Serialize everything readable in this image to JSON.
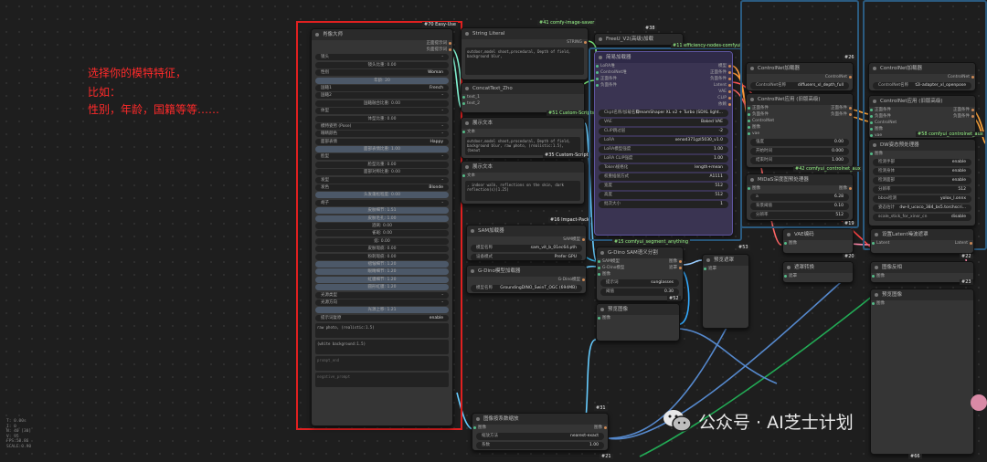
{
  "annotation": {
    "line1": "选择你的模特特征，",
    "line2": "比如：",
    "line3": "性别，年龄，国籍等等……"
  },
  "stats": [
    "T: 0.00s",
    "I: 0",
    "N: 40 [30]",
    "V: 95",
    "FPS:58.86",
    "SCALE:0.90"
  ],
  "watermark": {
    "text": "公众号 · AI芝士计划"
  },
  "nodes": {
    "portrait": {
      "tag": "#70 Easy-Use",
      "title": "肖像大师",
      "out1": "正面提示词",
      "out2": "负面提示词",
      "rows": [
        {
          "l": "镜头",
          "v": "-"
        },
        {
          "c": "镜头比重: 0.00"
        },
        {
          "l": "性别",
          "v": "Woman"
        },
        {
          "c": "年龄: 20",
          "s": true
        },
        {
          "l": "国籍1",
          "v": "French"
        },
        {
          "l": "国籍2",
          "v": "-"
        },
        {
          "c": "国籍融合比重: 0.00"
        },
        {
          "l": "体型",
          "v": "-"
        },
        {
          "c": "体型比重: 0.00"
        },
        {
          "l": "模特姿势 (Pose)",
          "v": "-"
        },
        {
          "l": "眼睛颜色",
          "v": "-"
        },
        {
          "l": "面部表情",
          "v": "Happy"
        },
        {
          "c": "面部表情比重: 1.00",
          "s": true
        },
        {
          "l": "脸型",
          "v": "-"
        },
        {
          "c": "脸型比重: 0.00"
        },
        {
          "c": "面部对称比重: 0.00"
        },
        {
          "l": "发型",
          "v": "-"
        },
        {
          "l": "发色",
          "v": "Blonde"
        },
        {
          "c": "头发蓬松程度: 0.00",
          "s": true
        },
        {
          "l": "胡子",
          "v": "-"
        },
        {
          "c": "皮肤细节: 1.51",
          "s": true
        },
        {
          "c": "皮肤毛孔: 1.00",
          "s": true
        },
        {
          "c": "酒窝: 0.00"
        },
        {
          "c": "雀斑: 0.00"
        },
        {
          "c": "痣: 0.00"
        },
        {
          "c": "皮肤瑕疵: 0.00"
        },
        {
          "c": "粉刺瑕疵: 0.00"
        },
        {
          "c": "褶皱细节: 1.20",
          "s": true
        },
        {
          "c": "眼睛细节: 1.20",
          "s": true
        },
        {
          "c": "虹膜细节: 1.20",
          "s": true
        },
        {
          "c": "圆形虹膜: 1.20",
          "s": true
        },
        {
          "l": "光源类型",
          "v": "-"
        },
        {
          "l": "光源方向",
          "v": "-"
        },
        {
          "c": "光源上移: 1.21",
          "s": true
        },
        {
          "l": "提示词复原",
          "v": "enable"
        }
      ],
      "texts": [
        "raw photo, (realistic:1.5)",
        "(white background:1.5)",
        "prompt_end",
        "negative_prompt"
      ]
    },
    "string_literal": {
      "tag": "#41 comfy-image-saver",
      "title": "String Literal",
      "out": "STRING",
      "text": "outdoor,model shoot,procedural, Depth of field, background blur,"
    },
    "concat": {
      "tag": "#51 Custom-Scripts",
      "title": "ConcatText_Zho",
      "in1": "text_1",
      "in2": "text_2",
      "out": "text"
    },
    "show1": {
      "tag": "#35 Custom-Scripts",
      "title": "展示文本",
      "in": "文本",
      "out": "字符串",
      "text": "outdoor,model shoot,procedural, Depth of field, background blur, raw photo, (realistic:1.5), (beaut"
    },
    "show2": {
      "title": "展示文本",
      "in": "文本",
      "out": "字符串",
      "text": ", indoor walk, reflections on the skin, dark reflection(s)(1.25)"
    },
    "sam_loader": {
      "tag": "#16 Impact-Pack",
      "title": "SAM加载器",
      "out": "SAM模型",
      "rows": [
        {
          "l": "模型名称",
          "v": "sam_vit_b_01ec64.pth"
        },
        {
          "l": "设备模式",
          "v": "Prefer GPU"
        }
      ]
    },
    "gdino_loader": {
      "title": "G-Dino模型加载器",
      "out": "G-Dino模型",
      "rows": [
        {
          "l": "模型名称",
          "v": "GroundingDINO_SwinT_OGC (694MB)"
        }
      ]
    },
    "freeu": {
      "tag": "#38",
      "title": "FreeU_V2(高级)加载"
    },
    "efficient": {
      "tag": "#11 efficiency-nodes-comfyui",
      "title": "简易加载器",
      "ins": [
        "LoRA堆",
        "ControlNet堆",
        "正面条件",
        "负面条件"
      ],
      "outs": [
        "模型",
        "正面条件",
        "负面条件",
        "Latent",
        "VAE",
        "CLIP",
        "依赖"
      ],
      "rows": [
        {
          "l": "Ckpt名称/加载名称",
          "v": "DreamShaper XL v2 + Turbo (SDXL light..."
        },
        {
          "l": "VAE",
          "v": "Baked VAE"
        },
        {
          "l": "CLIP跳过层",
          "v": "-2"
        },
        {
          "l": "LoRA",
          "v": "xenod371gzl5030_v1.0"
        },
        {
          "l": "LoRA模型强度",
          "v": "1.00"
        },
        {
          "l": "LoRA CLIP强度",
          "v": "1.00"
        },
        {
          "l": "Token规格化",
          "v": "length+mean"
        },
        {
          "l": "权重插值方式",
          "v": "A1111"
        },
        {
          "l": "宽度",
          "v": "512"
        },
        {
          "l": "高度",
          "v": "512"
        },
        {
          "l": "批次大小",
          "v": "1"
        }
      ]
    },
    "segment": {
      "tag": "#15 comfyui_segment_anything",
      "title": "G-Dino SAM语义分割",
      "ins": [
        "SAM模型",
        "G-Dino模型",
        "图像"
      ],
      "outs": [
        "图像",
        "遮罩"
      ],
      "rows": [
        {
          "l": "提示词",
          "v": "sunglasses"
        },
        {
          "l": "阈值",
          "v": "0.30"
        }
      ]
    },
    "preview_mask": {
      "title": "预览遮罩",
      "in": "遮罩",
      "tag": "#52"
    },
    "preview_img": {
      "title": "预览图像",
      "in": "图像"
    },
    "scale": {
      "tag": "#31",
      "title": "图像按系数缩放",
      "in": "图像",
      "out": "图像",
      "rows": [
        {
          "l": "缩放方法",
          "v": "nearest-exact"
        },
        {
          "l": "系数",
          "v": "1.00"
        }
      ],
      "tag2": "#21"
    },
    "cn_loader1": {
      "tag": "#26",
      "title": "ControlNet加载器",
      "out": "ControlNet",
      "row": {
        "l": "ControlNet名称",
        "v": "diffusers_xl_depth_full"
      }
    },
    "cn_apply1": {
      "title": "ControlNet应用 (旧版高级)",
      "ins": [
        "正面条件",
        "负面条件",
        "ControlNet",
        "图像",
        "vae"
      ],
      "outs": [
        "正面条件",
        "负面条件"
      ],
      "rows": [
        {
          "l": "强度",
          "v": "0.00"
        },
        {
          "l": "开始时间",
          "v": "0.000"
        },
        {
          "l": "结束时间",
          "v": "1.000"
        }
      ]
    },
    "midas": {
      "tag": "#42 comfyui_controlnet_aux",
      "title": "MiDaS深度图预处理器",
      "in": "图像",
      "out": "图像",
      "rows": [
        {
          "l": "a",
          "v": "6.28"
        },
        {
          "l": "背景阈值",
          "v": "0.10"
        },
        {
          "l": "分辨率",
          "v": "512"
        }
      ]
    },
    "cn_loader2": {
      "title": "ControlNet加载器",
      "out": "ControlNet",
      "row": {
        "l": "ControlNet名称",
        "v": "t2i-adapter_xl_openpose"
      }
    },
    "cn_apply2": {
      "title": "ControlNet应用 (旧版高级)",
      "ins": [
        "正面条件",
        "负面条件",
        "ControlNet",
        "图像",
        "vae"
      ],
      "outs": [
        "正面条件",
        "负面条件"
      ]
    },
    "dw": {
      "tag": "#58 comfyui_controlnet_aux",
      "title": "DW姿态预处理器",
      "in": "图像",
      "rows": [
        {
          "l": "检测手部",
          "v": "enable"
        },
        {
          "l": "检测身体",
          "v": "enable"
        },
        {
          "l": "检测面部",
          "v": "enable"
        },
        {
          "l": "分辨率",
          "v": "512"
        },
        {
          "l": "bbox检测",
          "v": "yolox_l.onnx"
        },
        {
          "l": "姿态估计",
          "v": "dw-ll_ucoco_384_bs5.torchscri..."
        },
        {
          "l": "scale_stick_for_xinsr_cn",
          "v": "disable"
        }
      ]
    },
    "vae_enc": {
      "tag": "#20",
      "title": "VAE编码",
      "ins": [
        "图像",
        "VAE"
      ],
      "out": "Latent"
    },
    "latent_size": {
      "tag": "#22",
      "title": "设置Latent噪波遮罩",
      "ins": [
        "Latent",
        "遮罩"
      ],
      "out": "Latent"
    },
    "prep1": {
      "tag": "#23",
      "title": "图像反相",
      "in": "图像",
      "out": "图像"
    },
    "prep2": {
      "title": "遮罩转换",
      "in": "遮罩",
      "out": "图像"
    },
    "preview3": {
      "title": "预览图像",
      "in": "图像"
    },
    "tag_19": "#19",
    "tag_53": "#53",
    "tag_66": "#66"
  }
}
